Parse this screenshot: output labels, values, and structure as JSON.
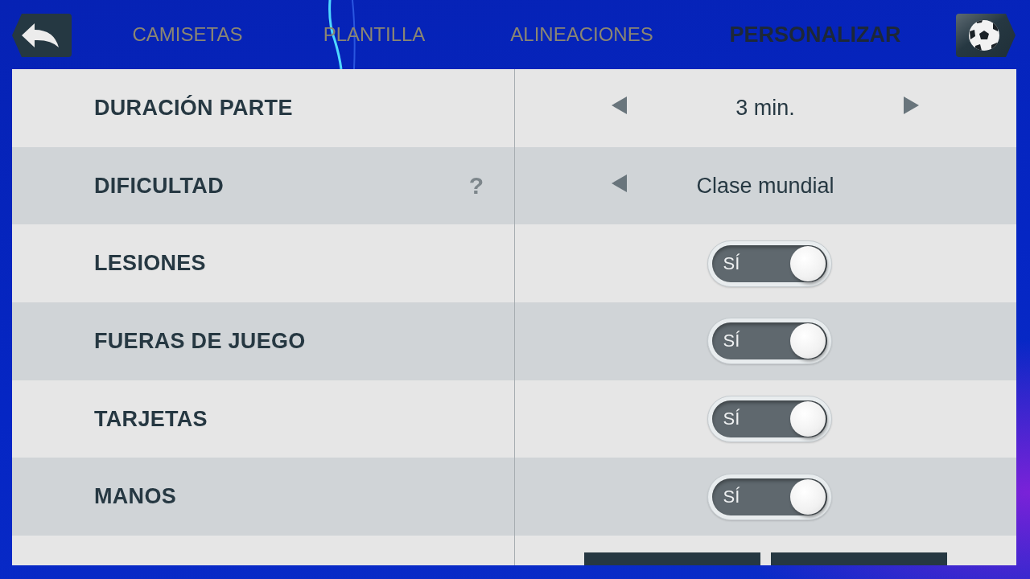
{
  "top_bar": {
    "tabs": [
      {
        "label": "CAMISETAS",
        "selected": false
      },
      {
        "label": "PLANTILLA",
        "selected": false
      },
      {
        "label": "ALINEACIONES",
        "selected": false
      },
      {
        "label": "PERSONALIZAR",
        "selected": true
      }
    ]
  },
  "settings": [
    {
      "kind": "selector",
      "label": "DURACIÓN PARTE",
      "value": "3 min.",
      "can_decrease": true,
      "can_increase": true
    },
    {
      "kind": "selector",
      "label": "DIFICULTAD",
      "help": "?",
      "value": "Clase mundial",
      "can_decrease": true,
      "can_increase": false
    },
    {
      "kind": "toggle",
      "label": "LESIONES",
      "on": true,
      "state_label": "SÍ"
    },
    {
      "kind": "toggle",
      "label": "FUERAS DE JUEGO",
      "on": true,
      "state_label": "SÍ"
    },
    {
      "kind": "toggle",
      "label": "TARJETAS",
      "on": true,
      "state_label": "SÍ"
    },
    {
      "kind": "toggle",
      "label": "MANOS",
      "on": true,
      "state_label": "SÍ"
    },
    {
      "kind": "actions",
      "buttons": [
        {
          "kind": "button"
        },
        {
          "kind": "button"
        }
      ]
    }
  ]
}
